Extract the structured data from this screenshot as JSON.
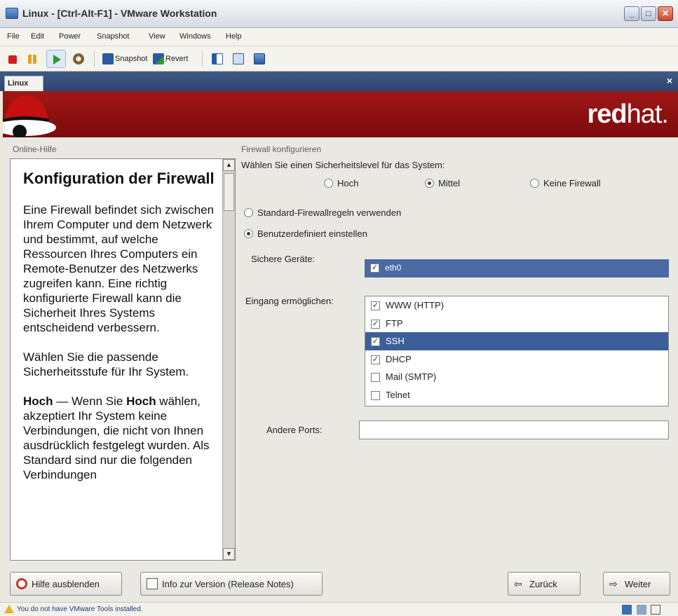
{
  "window": {
    "title": "Linux - [Ctrl-Alt-F1] - VMware Workstation",
    "minimize": "_",
    "maximize": "□",
    "close": "✕"
  },
  "menu": [
    "File",
    "Edit",
    "Power",
    "Snapshot",
    "View",
    "Windows",
    "Help"
  ],
  "toolbar": {
    "snapshot_label": "Snapshot",
    "revert_label": "Revert"
  },
  "vm_tab": {
    "label": "Linux",
    "close": "×"
  },
  "banner": {
    "logo_bold": "red",
    "logo_light": "hat."
  },
  "help": {
    "section_title": "Online-Hilfe",
    "heading": "Konfiguration der Firewall",
    "para1": "Eine Firewall befindet sich zwischen Ihrem Computer und dem Netzwerk und bestimmt, auf welche Ressourcen Ihres Computers ein Remote-Benutzer des Netzwerks zugreifen kann. Eine richtig konfigurierte Firewall kann die Sicherheit Ihres Systems entscheidend verbessern.",
    "para2": "Wählen Sie die passende Sicherheitsstufe für Ihr System.",
    "para3_bold": "Hoch",
    "para3_a": " — Wenn Sie ",
    "para3_bold2": "Hoch",
    "para3_b": " wählen, akzeptiert Ihr System keine Verbindungen, die nicht von Ihnen ausdrücklich festgelegt wurden. Als Standard sind nur die folgenden Verbindungen"
  },
  "firewall": {
    "section_title": "Firewall konfigurieren",
    "prompt": "Wählen Sie einen Sicherheitslevel für das System:",
    "levels": [
      {
        "label": "Hoch",
        "selected": false
      },
      {
        "label": "Mittel",
        "selected": true
      },
      {
        "label": "Keine Firewall",
        "selected": false
      }
    ],
    "rules": [
      {
        "label": "Standard-Firewallregeln verwenden",
        "selected": false
      },
      {
        "label": "Benutzerdefiniert einstellen",
        "selected": true
      }
    ],
    "trusted_label": "Sichere Geräte:",
    "trusted_devices": [
      {
        "name": "eth0",
        "checked": true
      }
    ],
    "allow_label": "Eingang ermöglichen:",
    "allow_services": [
      {
        "name": "WWW (HTTP)",
        "checked": true,
        "selected": false
      },
      {
        "name": "FTP",
        "checked": true,
        "selected": false
      },
      {
        "name": "SSH",
        "checked": true,
        "selected": true
      },
      {
        "name": "DHCP",
        "checked": true,
        "selected": false
      },
      {
        "name": "Mail (SMTP)",
        "checked": false,
        "selected": false
      },
      {
        "name": "Telnet",
        "checked": false,
        "selected": false
      }
    ],
    "other_ports_label": "Andere Ports:",
    "other_ports_value": ""
  },
  "buttons": {
    "hide_help": "Hilfe ausblenden",
    "release_notes": "Info zur Version (Release Notes)",
    "back": "Zurück",
    "next": "Weiter"
  },
  "status": {
    "message": "You do not have VMware Tools installed."
  },
  "colors": {
    "banner": "#8f1010",
    "selection": "#3d5f99",
    "accent": "#2d4470"
  }
}
